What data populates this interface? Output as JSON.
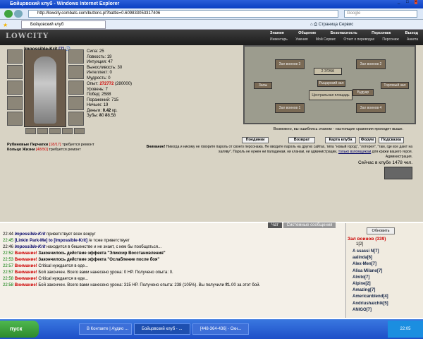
{
  "window": {
    "title": "Бойцовский клуб - Windows Internet Explorer"
  },
  "address": {
    "url": "http://lowcity.combats.com/buttons.pl?battle=0.609833053317406"
  },
  "search": {
    "placeholder": "Google"
  },
  "tab": {
    "label": "Бойцовский клуб"
  },
  "ie_tools": {
    "page": "Страница",
    "service": "Сервис"
  },
  "game": {
    "logo": "LOWCITY",
    "nav": [
      "Знания",
      "Общение",
      "Безопасность",
      "Персонаж",
      "Выход"
    ],
    "subnav": [
      "Инвентарь",
      "Умения",
      "Мой Сервис",
      "Отчет о переводах",
      "Персонаж",
      "Анкета"
    ]
  },
  "character": {
    "name": "Impossible-Krit",
    "level_badge": "[7]",
    "hp": "1/394",
    "stats": {
      "strength": "Сила: 25",
      "agility": "Ловкость: 19",
      "intuition": "Интуиция: 47",
      "endurance": "Выносливость: 30",
      "intellect": "Интеллект: 0",
      "wisdom": "Мудрость: 0"
    },
    "exp_label": "Опыт:",
    "exp": "272772",
    "exp_next": "(280000)",
    "level": "Уровень: 7",
    "wins": "Побед: 2588",
    "losses": "Поражений: 715",
    "draws": "Ничьих: 19",
    "money_label": "Деньги:",
    "money": "0.42",
    "money_unit": "кр.",
    "teeth": "Зубы: ₴0 ₴8.58",
    "repair1_item": "Рубиновые Перчатки",
    "repair1_dur": "[18/17]",
    "repair1_text": "требуется ремонт",
    "repair2_item": "Кольцо Жизни",
    "repair2_dur": "[48/50]",
    "repair2_text": "требуется ремонт"
  },
  "map": {
    "rooms": [
      "Зал воинов 3",
      "Зал воинов 2",
      "Зал воинов 1",
      "Зал воинов 4",
      "Залы",
      "2 ЭТАЖ",
      "Торговый зал",
      "Будуар",
      "Рыцарский зал",
      "Центральная площадь"
    ],
    "notice": "Возможно, вы ошиблись этажом - настоящие сражения проходят выше."
  },
  "buttons": [
    "Поединки",
    "Возврат",
    "Карта клуба",
    "Форум",
    "Подсказка"
  ],
  "warning": {
    "label": "Внимание!",
    "text": "Никогда и никому не говорите пароль от своего персонажа. Не вводите пароль на других сайтах, типа \"новый город\", \"лотерея\", \"там, где все дают на халяву\". Пароль не нужен ни паладинам, ни кланам, ни администрации,",
    "link": "только взломщикам",
    "tail": "для кражи вашего героя.",
    "signature": "Администрация.",
    "online": "Сейчас в клубе 1478 чел."
  },
  "chat": {
    "tabs": [
      "Чат",
      "Системные сообщения"
    ],
    "lines": [
      {
        "time": "22:44",
        "name": "Impossible-Krit",
        "text": "приветствует всех вокруг"
      },
      {
        "time": "22:45",
        "name": "[Linkin Park-Me] to [Impossible-Krit]",
        "text": "/е тоже приветствует"
      },
      {
        "time": "22:46",
        "name": "Impossible-Krit",
        "text": "находится в бешенстве и не знает, с кем бы пообщаться..."
      },
      {
        "time": "22:52",
        "warn": "Внимание!",
        "text": "Закончилось действие эффекта \"Эликсир Восстановления\""
      },
      {
        "time": "22:53",
        "warn": "Внимание!",
        "text": "Закончилось действие эффекта \"Ослабление после боя\""
      },
      {
        "time": "22:57",
        "warn": "Внимание!",
        "text": "Critical нуждается в еде..."
      },
      {
        "time": "22:57",
        "warn": "Внимание!",
        "text": "Бой закончен. Всего вами нанесено урона: 0 HP. Получено опыта: 0."
      },
      {
        "time": "22:58",
        "warn": "Внимание!",
        "text": "Critical нуждается в еде..."
      },
      {
        "time": "22:58",
        "warn": "Внимание!",
        "text": "Бой закончен. Всего вами нанесено урона: 315 HP. Получено опыта: 238 (105%). Вы получили ₴1.00 за этот бой."
      }
    ]
  },
  "warriors": {
    "refresh": "Обновить",
    "title": "Зал воинов (339)",
    "pages": "1[2]",
    "names": [
      "A ssassi N[7]",
      "aalinda[6]",
      "Alex-Men[7]",
      "Alisa Milano[7]",
      "Alnito[7]",
      "Alpine[2]",
      "Amazing[7]",
      "Americanblend[4]",
      "Andriushaichik[5]",
      "ANIGO[7]"
    ]
  },
  "taskbar": {
    "start": "пуск",
    "tasks": [
      "В Контакте | Аудио ...",
      "Бойцовский клуб - ...",
      "[448-364-436] - Окн..."
    ],
    "clock": "22:05"
  }
}
